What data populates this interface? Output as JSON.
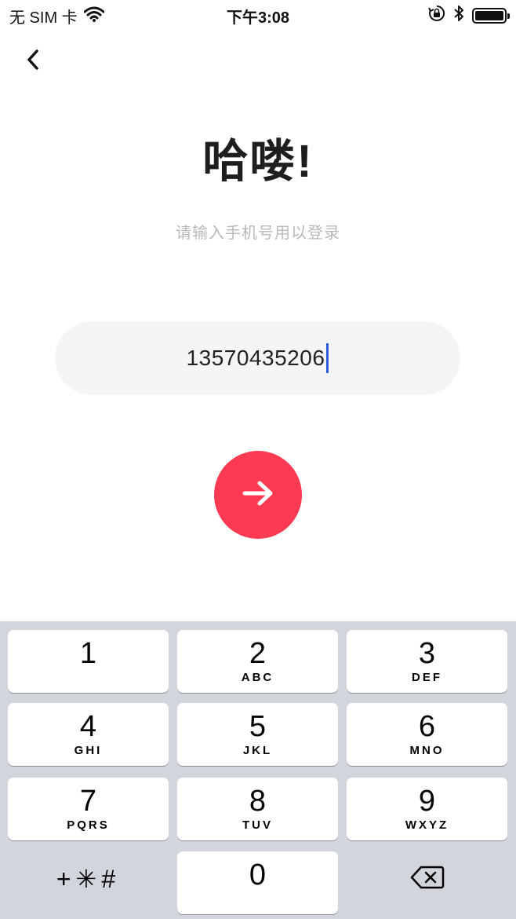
{
  "status_bar": {
    "carrier": "无 SIM 卡",
    "time": "下午3:08"
  },
  "header": {
    "title": "哈喽!",
    "subtitle": "请输入手机号用以登录"
  },
  "phone_input": {
    "value": "13570435206"
  },
  "colors": {
    "accent": "#fe3a53",
    "caret": "#2f5bd8",
    "input_bg": "#f5f5f5",
    "keyboard_bg": "#d2d5db"
  },
  "keypad": {
    "keys": [
      {
        "digit": "1",
        "letters": ""
      },
      {
        "digit": "2",
        "letters": "ABC"
      },
      {
        "digit": "3",
        "letters": "DEF"
      },
      {
        "digit": "4",
        "letters": "GHI"
      },
      {
        "digit": "5",
        "letters": "JKL"
      },
      {
        "digit": "6",
        "letters": "MNO"
      },
      {
        "digit": "7",
        "letters": "PQRS"
      },
      {
        "digit": "8",
        "letters": "TUV"
      },
      {
        "digit": "9",
        "letters": "WXYZ"
      },
      {
        "digit": "0",
        "letters": ""
      }
    ],
    "symbols_label": "+✳#"
  },
  "icons": {
    "back": "chevron-left-icon",
    "go": "arrow-right-icon",
    "delete": "backspace-icon",
    "wifi": "wifi-icon",
    "lock": "orientation-lock-icon",
    "bluetooth": "bluetooth-icon",
    "battery": "battery-icon"
  }
}
